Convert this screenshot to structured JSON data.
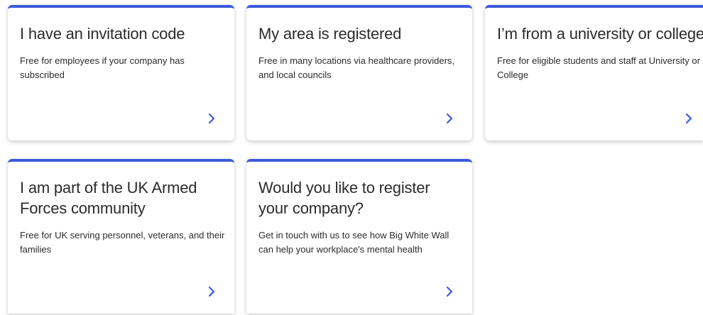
{
  "cards": [
    {
      "title": "I have an invitation code",
      "description": "Free for employees if your company has subscribed",
      "chevron_icon": "chevron-right-icon"
    },
    {
      "title": "My area is registered",
      "description": "Free in many locations via healthcare providers, and local councils",
      "chevron_icon": "chevron-right-icon"
    },
    {
      "title": "I’m from a university or college",
      "description": "Free for eligible students and staff at University or College",
      "chevron_icon": "chevron-right-icon"
    },
    {
      "title": "I am part of the UK Armed Forces community",
      "description": "Free for UK serving personnel, veterans, and their families",
      "chevron_icon": "chevron-right-icon"
    },
    {
      "title": "Would you like to register your company?",
      "description": "Get in touch with us to see how Big White Wall can help your workplace's mental health",
      "chevron_icon": "chevron-right-icon"
    }
  ],
  "colors": {
    "accent": "#3b5bdb",
    "text": "#2b2b2b"
  }
}
